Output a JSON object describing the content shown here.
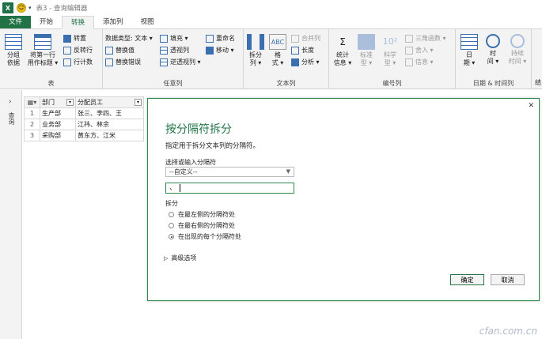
{
  "window": {
    "title": "表3 - 查询编辑器"
  },
  "tabs": [
    "文件",
    "开始",
    "转换",
    "添加列",
    "视图"
  ],
  "ribbon": {
    "table_group": {
      "label": "表",
      "group_by": "分组\n依据",
      "first_row_header": "将第一行\n用作标题 ▾",
      "transpose": "转置",
      "reverse_rows": "反转行",
      "count_rows": "行计数"
    },
    "any_column_group": {
      "label": "任意列",
      "data_type": "数据类型: 文本 ▾",
      "replace_values": "替换值",
      "replace_errors": "替换错误",
      "fill": "填充 ▾",
      "pivot_column": "透视列",
      "unpivot_columns": "逆透视列 ▾",
      "rename": "重命名",
      "move": "移动 ▾"
    },
    "text_column_group": {
      "label": "文本列",
      "split_column": "拆分\n列 ▾",
      "format": "格\n式 ▾",
      "merge_columns": "合并列",
      "length": "长度",
      "analyze": "分析 ▾"
    },
    "number_column_group": {
      "label": "编号列",
      "statistics": "统计\n信息 ▾",
      "standard": "标准\n型 ▾",
      "scientific": "科学\n型 ▾",
      "trig": "三角函数 ▾",
      "rounding": "舍入 ▾",
      "information": "信息 ▾"
    },
    "date_time_group": {
      "label": "日期 & 时间列",
      "date": "日\n期 ▾",
      "time": "时\n间 ▾",
      "duration": "持续\n时间 ▾"
    },
    "overflow_label": "结"
  },
  "leftnav": {
    "label": "查询"
  },
  "table": {
    "headers": [
      "部门",
      "分配员工"
    ],
    "rows": [
      {
        "n": "1",
        "dept": "生产部",
        "emp": "张三、李四、王"
      },
      {
        "n": "2",
        "dept": "业务部",
        "emp": "江祎、林余"
      },
      {
        "n": "3",
        "dept": "采购部",
        "emp": "黄东方、江米"
      }
    ]
  },
  "dialog": {
    "title": "按分隔符拆分",
    "description": "指定用于拆分文本列的分隔符。",
    "select_label": "选择或输入分隔符",
    "select_value": "--自定义--",
    "input_value": "、",
    "split_label": "拆分",
    "options": [
      {
        "label": "在最左侧的分隔符处",
        "selected": false
      },
      {
        "label": "在最右侧的分隔符处",
        "selected": false
      },
      {
        "label": "在出现的每个分隔符处",
        "selected": true
      }
    ],
    "advanced": "高级选项",
    "ok": "确定",
    "cancel": "取消"
  },
  "watermark": "cfan.com.cn"
}
